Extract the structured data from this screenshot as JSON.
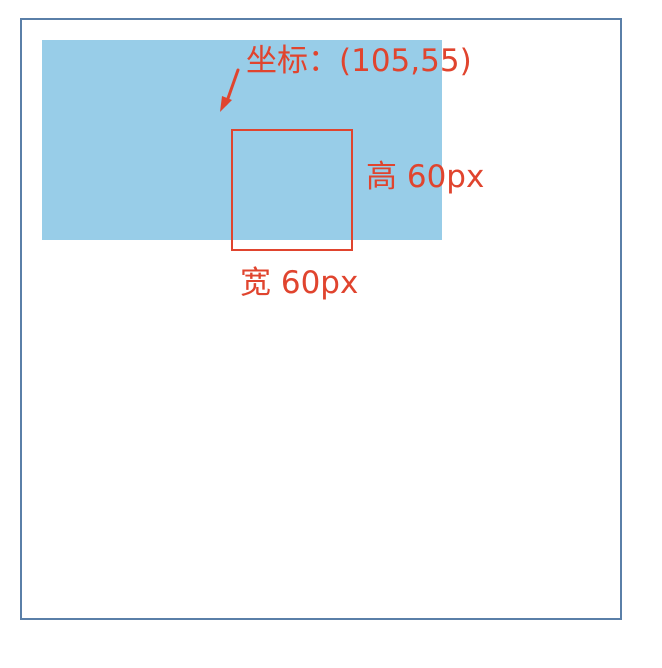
{
  "colors": {
    "frame_border": "#5a7fa8",
    "blue_region": "#98cde8",
    "annotation": "#e0442e",
    "background": "#ffffff"
  },
  "annotations": {
    "coordinate": "坐标：(105,55)",
    "height": "高 60px",
    "width": "宽 60px"
  },
  "icons": {
    "pointer": "arrow-down-left-icon"
  }
}
